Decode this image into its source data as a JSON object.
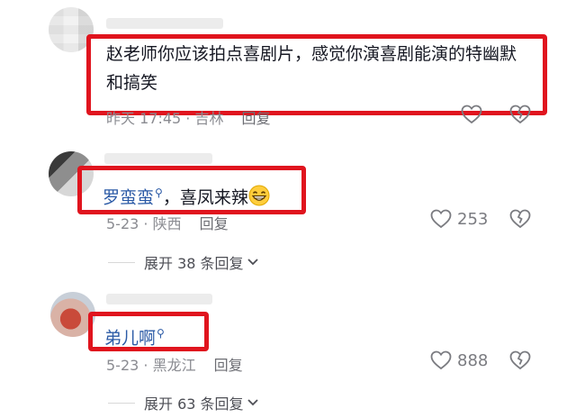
{
  "comments": [
    {
      "text": "赵老师你应该拍点喜剧片，感觉你演喜剧能演的特幽默和搞笑",
      "meta": "昨天 17:45 · 吉林",
      "reply_label": "回复"
    },
    {
      "mention": "罗蛮蛮",
      "text": "，喜凤来辣",
      "emoji": "grinning-face-icon",
      "meta": "5-23 · 陕西",
      "reply_label": "回复",
      "likes": "253",
      "expand_label": "展开 38 条回复"
    },
    {
      "mention": "弟儿啊",
      "meta": "5-23 · 黑龙江",
      "reply_label": "回复",
      "likes": "888",
      "expand_label": "展开 63 条回复"
    }
  ],
  "colors": {
    "highlight_box": "#e0141e",
    "mention": "#2b5aa6",
    "meta": "#8a8b91"
  }
}
